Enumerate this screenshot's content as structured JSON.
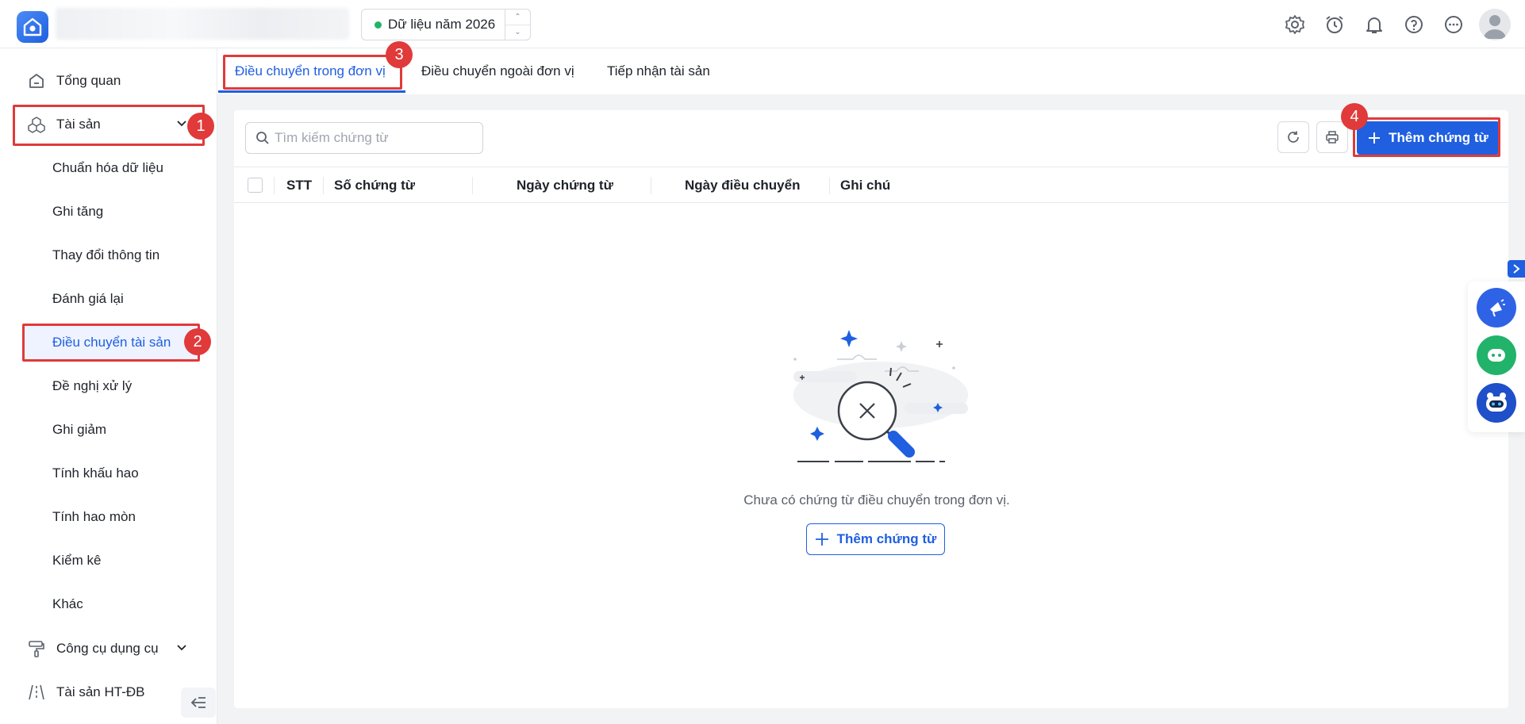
{
  "header": {
    "year_label": "Dữ liệu năm 2026",
    "icons": [
      "settings-icon",
      "alarm-clock-icon",
      "bell-icon",
      "help-icon",
      "more-icon",
      "user-avatar"
    ]
  },
  "sidebar": {
    "items": [
      {
        "label": "Tổng quan",
        "icon": "home-icon"
      },
      {
        "label": "Tài sản",
        "icon": "cubes-icon"
      },
      {
        "label": "Công cụ dụng cụ",
        "icon": "paint-roller-icon"
      },
      {
        "label": "Tài sản HT-ĐB",
        "icon": "road-icon"
      }
    ],
    "sub_items": [
      "Chuẩn hóa dữ liệu",
      "Ghi tăng",
      "Thay đổi thông tin",
      "Đánh giá lại",
      "Điều chuyển tài sản",
      "Đề nghị xử lý",
      "Ghi giảm",
      "Tính khấu hao",
      "Tính hao mòn",
      "Kiểm kê",
      "Khác"
    ]
  },
  "tabs": [
    {
      "label": "Điều chuyển trong đơn vị",
      "active": true
    },
    {
      "label": "Điều chuyển ngoài đơn vị",
      "active": false
    },
    {
      "label": "Tiếp nhận tài sản",
      "active": false
    }
  ],
  "toolbar": {
    "search_placeholder": "Tìm kiếm chứng từ",
    "add_label": "Thêm chứng từ"
  },
  "table": {
    "columns": [
      "STT",
      "Số chứng từ",
      "Ngày chứng từ",
      "Ngày điều chuyển",
      "Ghi chú"
    ],
    "rows": []
  },
  "empty_state": {
    "message": "Chưa có chứng từ điều chuyển trong đơn vị.",
    "button_label": "Thêm chứng từ"
  },
  "annotations": [
    "1",
    "2",
    "3",
    "4"
  ],
  "colors": {
    "accent": "#1f5fe0",
    "annotation": "#e03a3a",
    "status_dot": "#22b36b"
  }
}
